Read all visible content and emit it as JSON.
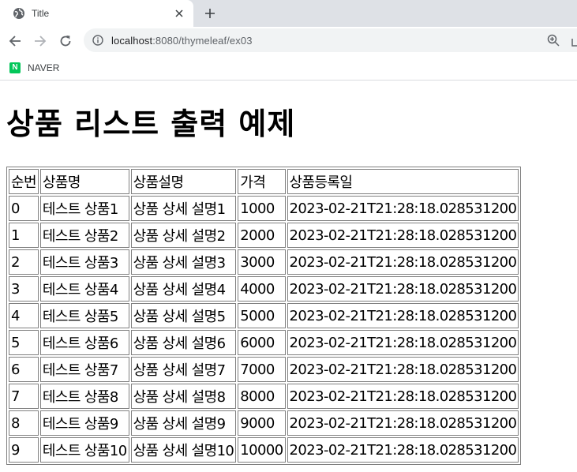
{
  "browser": {
    "tab_title": "Title",
    "url_host": "localhost",
    "url_rest": ":8080/thymeleaf/ex03",
    "bookmark_label": "NAVER",
    "bookmark_logo": "N"
  },
  "page": {
    "heading": "상품 리스트 출력 예제",
    "headers": [
      "순번",
      "상품명",
      "상품설명",
      "가격",
      "상품등록일"
    ],
    "rows": [
      [
        "0",
        "테스트 상품1",
        "상품 상세 설명1",
        "1000",
        "2023-02-21T21:28:18.028531200"
      ],
      [
        "1",
        "테스트 상품2",
        "상품 상세 설명2",
        "2000",
        "2023-02-21T21:28:18.028531200"
      ],
      [
        "2",
        "테스트 상품3",
        "상품 상세 설명3",
        "3000",
        "2023-02-21T21:28:18.028531200"
      ],
      [
        "3",
        "테스트 상품4",
        "상품 상세 설명4",
        "4000",
        "2023-02-21T21:28:18.028531200"
      ],
      [
        "4",
        "테스트 상품5",
        "상품 상세 설명5",
        "5000",
        "2023-02-21T21:28:18.028531200"
      ],
      [
        "5",
        "테스트 상품6",
        "상품 상세 설명6",
        "6000",
        "2023-02-21T21:28:18.028531200"
      ],
      [
        "6",
        "테스트 상품7",
        "상품 상세 설명7",
        "7000",
        "2023-02-21T21:28:18.028531200"
      ],
      [
        "7",
        "테스트 상품8",
        "상품 상세 설명8",
        "8000",
        "2023-02-21T21:28:18.028531200"
      ],
      [
        "8",
        "테스트 상품9",
        "상품 상세 설명9",
        "9000",
        "2023-02-21T21:28:18.028531200"
      ],
      [
        "9",
        "테스트 상품10",
        "상품 상세 설명10",
        "10000",
        "2023-02-21T21:28:18.028531200"
      ]
    ]
  },
  "icons": {
    "favicon": "globe-icon",
    "close": "close-icon",
    "new_tab": "plus-icon",
    "back": "back-arrow-icon",
    "forward": "forward-arrow-icon",
    "reload": "reload-icon",
    "info": "info-icon",
    "zoom": "zoom-icon"
  },
  "colors": {
    "tabstrip": "#dee1e6",
    "omnibox": "#f1f3f4",
    "naver_green": "#03c75a",
    "table_border": "#808080"
  }
}
